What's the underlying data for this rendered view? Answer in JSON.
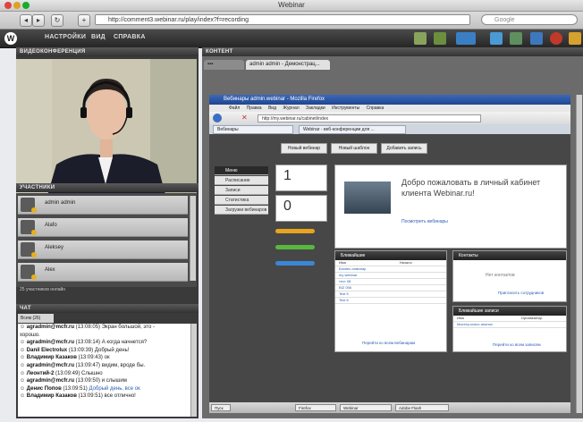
{
  "window": {
    "title": "Webinar"
  },
  "browser": {
    "url": "http://comment3.webinar.ru/play/index?f=recording",
    "search_placeholder": "Google",
    "nav": {
      "back": "◂",
      "forward": "▸",
      "reload": "↻",
      "add": "+"
    }
  },
  "app": {
    "logo": "W",
    "menu": [
      "НАСТРОЙКИ",
      "ВИД",
      "СПРАВКА"
    ]
  },
  "panels": {
    "video_title": "ВИДЕОКОНФЕРЕНЦИЯ",
    "participants_title": "УЧАСТНИКИ",
    "participants_count": "25 участников онлайн",
    "chat_title": "ЧАТ",
    "chat_tab": "Всем (26)",
    "content_title": "КОНТЕНТ",
    "content_tab": "admin admin - Демонстрац..."
  },
  "participants": [
    {
      "name": "admin admin"
    },
    {
      "name": "Alafo"
    },
    {
      "name": "Aleksey"
    },
    {
      "name": "Alex"
    }
  ],
  "chat": [
    {
      "author": "agradmin@mcfr.ru",
      "time": "(13:08:05)",
      "text": "Экран большой, это -"
    },
    {
      "author": "",
      "time": "",
      "text": "хорошо."
    },
    {
      "author": "agradmin@mcfr.ru",
      "time": "(13:08:14)",
      "text": "А когда начнется?"
    },
    {
      "author": "Danil Electrolux",
      "time": "(13:09:39)",
      "text": "Добрый день!"
    },
    {
      "author": "Владимир Казаков",
      "time": "(13:09:43)",
      "text": "ок"
    },
    {
      "author": "agradmin@mcfr.ru",
      "time": "(13:09:47)",
      "text": "видим, вроде бы."
    },
    {
      "author": "Леонтий-2",
      "time": "(13:09:49)",
      "text": "Слышно"
    },
    {
      "author": "agradmin@mcfr.ru",
      "time": "(13:09:50)",
      "text": "и слышим"
    },
    {
      "author": "Денис Попов",
      "time": "(13:09:51)",
      "text": "Добрый день, все ок"
    },
    {
      "author": "Владимир Казаков",
      "time": "(13:09:51)",
      "text": "все отлично!"
    }
  ],
  "shared_screen": {
    "title": "Вебинары admin.webinar - Mozilla Firefox",
    "menu": [
      "Файл",
      "Правка",
      "Вид",
      "Журнал",
      "Закладки",
      "Инструменты",
      "Справка"
    ],
    "url": "http://my.webinar.ru/cabinet/index",
    "tabs": [
      "Вебинары",
      "Webinar - веб-конференции для ..."
    ],
    "welcome_line1": "Добро пожаловать в личный кабинет",
    "welcome_line2": "клиента Webinar.ru!",
    "welcome_link": "Посмотреть вебинары",
    "sidebar": [
      "Меню",
      "Расписание",
      "Записи",
      "Статистика",
      "Загрузки вебинаров"
    ],
    "stat1": "1",
    "stat2": "0",
    "buttons": [
      "Новый вебинар",
      "Новый шаблон",
      "Добавить запись"
    ],
    "upcoming_title": "Ближайшие",
    "upcoming_col1": "Имя",
    "upcoming_col2": "Начало",
    "upcoming": [
      "Бизнес-семинар",
      "my webinar",
      "тест 08",
      "BIZ 056",
      "Test 5",
      "Test 6"
    ],
    "upcoming_link": "Перейти ко всем вебинарам",
    "contacts_title": "Контакты",
    "contacts_empty": "Нет контактов",
    "contacts_link": "Пригласить сотрудников",
    "records_title": "Ближайшие записи",
    "records_col1": "Имя",
    "records_col2": "Организатор",
    "records": [
      "Мастер-класс анализ"
    ],
    "records_link": "Перейти ко всем записям",
    "taskbar": [
      "Пуск",
      "Firefox",
      "Webinar",
      "Adobe Flash"
    ]
  }
}
